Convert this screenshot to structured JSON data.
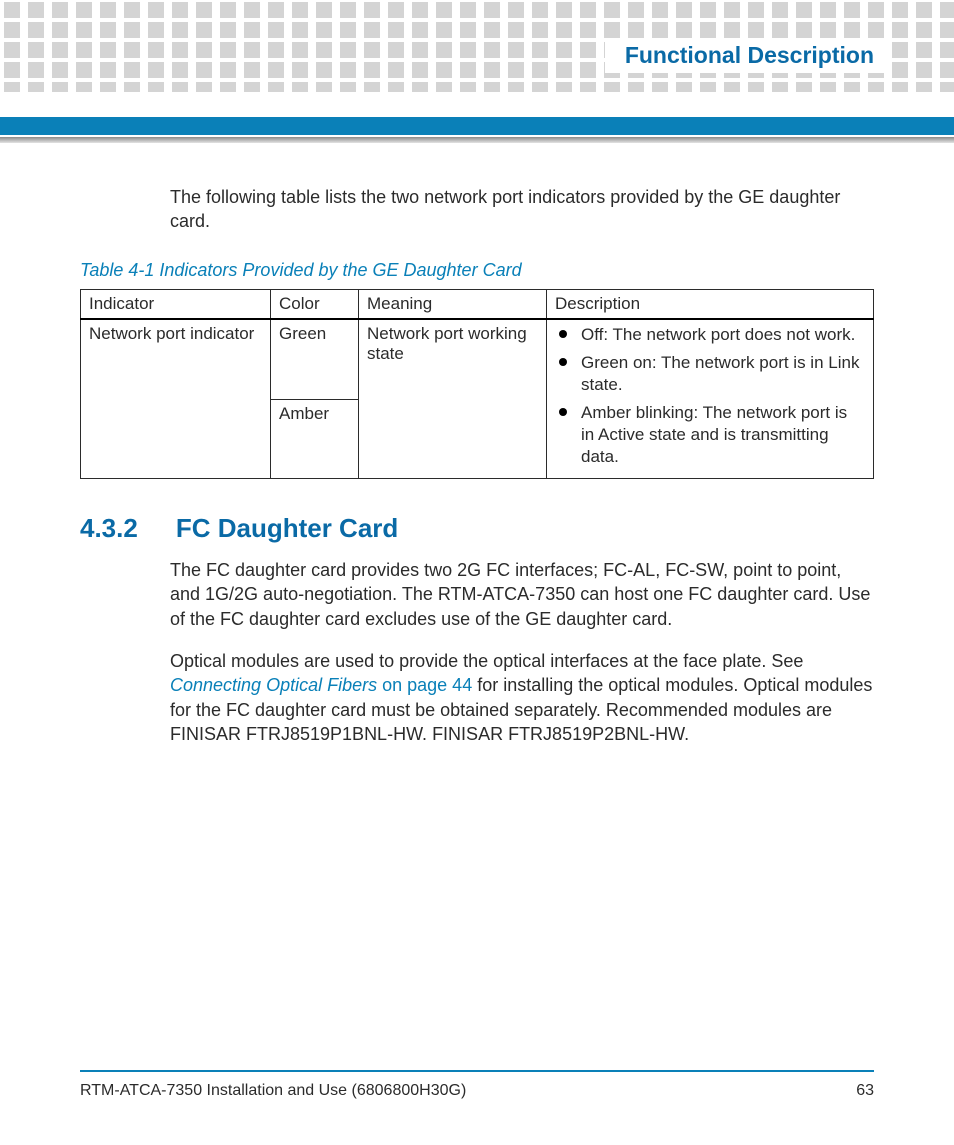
{
  "header": {
    "chapter_title": "Functional Description"
  },
  "intro": "The following table lists the two network port indicators provided by the GE daughter card.",
  "table": {
    "caption": "Table 4-1 Indicators Provided by the GE Daughter Card",
    "headers": {
      "indicator": "Indicator",
      "color": "Color",
      "meaning": "Meaning",
      "description": "Description"
    },
    "row": {
      "indicator": "Network port indicator",
      "color1": "Green",
      "color2": "Amber",
      "meaning": "Network port working state",
      "desc_items": {
        "0": "Off: The network port does not work.",
        "1": "Green on: The network port is in Link state.",
        "2": "Amber blinking: The network port is in Active state and is transmitting data."
      }
    }
  },
  "section": {
    "number": "4.3.2",
    "title": "FC Daughter Card",
    "para1": "The FC daughter card provides two 2G FC interfaces; FC-AL, FC-SW, point to point, and 1G/2G auto-negotiation. The RTM-ATCA-7350 can host one FC daughter card. Use of the FC daughter card excludes use of the GE daughter card.",
    "para2_pre": "Optical modules are used to provide the optical interfaces at the face plate. See ",
    "para2_link_title": "Connecting Optical Fibers",
    "para2_link_page": " on page 44",
    "para2_post": " for installing the optical modules. Optical modules for the FC daughter card must be obtained separately. Recommended modules are FINISAR FTRJ8519P1BNL-HW. FINISAR FTRJ8519P2BNL-HW."
  },
  "footer": {
    "doc": "RTM-ATCA-7350 Installation and Use (6806800H30G)",
    "page": "63"
  }
}
